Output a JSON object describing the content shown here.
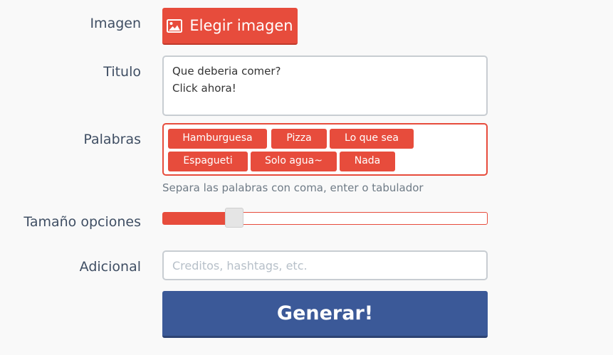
{
  "labels": {
    "image": "Imagen",
    "title": "Titulo",
    "words": "Palabras",
    "option_size": "Tamaño opciones",
    "additional": "Adicional"
  },
  "image_button": {
    "label": "Elegir imagen",
    "icon": "image-icon"
  },
  "title_field": {
    "value": "Que deberia comer?\nClick ahora!"
  },
  "tags": [
    "Hamburguesa",
    "Pizza",
    "Lo que sea",
    "Espagueti",
    "Solo agua~",
    "Nada"
  ],
  "words_help": "Separa las palabras con coma, enter o tabulador",
  "option_size_slider": {
    "fraction": 0.22
  },
  "additional_field": {
    "placeholder": "Creditos, hashtags, etc.",
    "value": ""
  },
  "generate_button": {
    "label": "Generar!"
  },
  "colors": {
    "accent_red": "#e74c3c",
    "generate_blue": "#3b5998"
  }
}
